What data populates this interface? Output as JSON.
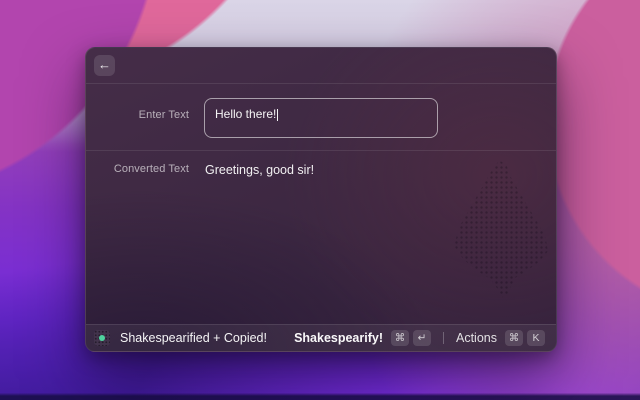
{
  "window": {
    "header": {
      "back_label": "←"
    },
    "form": {
      "input_label": "Enter Text",
      "input_value": "Hello there!",
      "output_label": "Converted Text",
      "output_value": "Greetings, good sir!"
    },
    "statusbar": {
      "status_text": "Shakespearified + Copied!",
      "primary_action_label": "Shakespearify!",
      "primary_action_keys": [
        "⌘",
        "↵"
      ],
      "secondary_action_label": "Actions",
      "secondary_action_keys": [
        "⌘",
        "K"
      ]
    }
  },
  "colors": {
    "status_dot_green": "#4fd39e",
    "window_bg": "#3d2842",
    "wallpaper_magenta": "#b245ae",
    "wallpaper_pink": "#e0689b",
    "wallpaper_rose": "#cb5f9e",
    "wallpaper_violet": "#7a2ed2"
  }
}
